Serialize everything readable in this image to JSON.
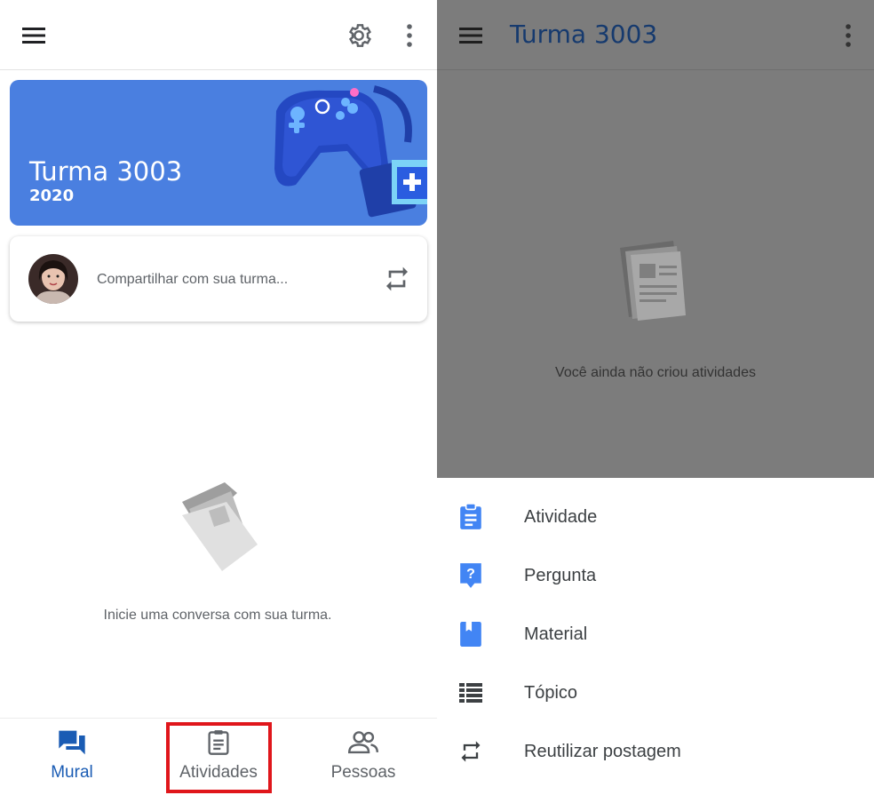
{
  "left": {
    "class_name": "Turma 3003",
    "class_year": "2020",
    "share_placeholder": "Compartilhar com sua turma...",
    "empty_message": "Inicie uma conversa com sua turma.",
    "nav": [
      {
        "label": "Mural",
        "icon": "forum-icon",
        "active": true
      },
      {
        "label": "Atividades",
        "icon": "assignment-icon",
        "active": false
      },
      {
        "label": "Pessoas",
        "icon": "people-icon",
        "active": false
      }
    ]
  },
  "right": {
    "title": "Turma 3003",
    "empty_message": "Você ainda não criou atividades",
    "create_menu": [
      {
        "label": "Atividade",
        "icon": "assignment-icon"
      },
      {
        "label": "Pergunta",
        "icon": "question-icon"
      },
      {
        "label": "Material",
        "icon": "book-icon"
      },
      {
        "label": "Tópico",
        "icon": "topic-list-icon"
      },
      {
        "label": "Reutilizar postagem",
        "icon": "repost-icon"
      }
    ]
  },
  "colors": {
    "accent": "#1a5cb4",
    "banner": "#4a7fe0",
    "menu_icon": "#4285f4",
    "highlight": "#e0161b",
    "scrim": "#7c7c7c"
  }
}
